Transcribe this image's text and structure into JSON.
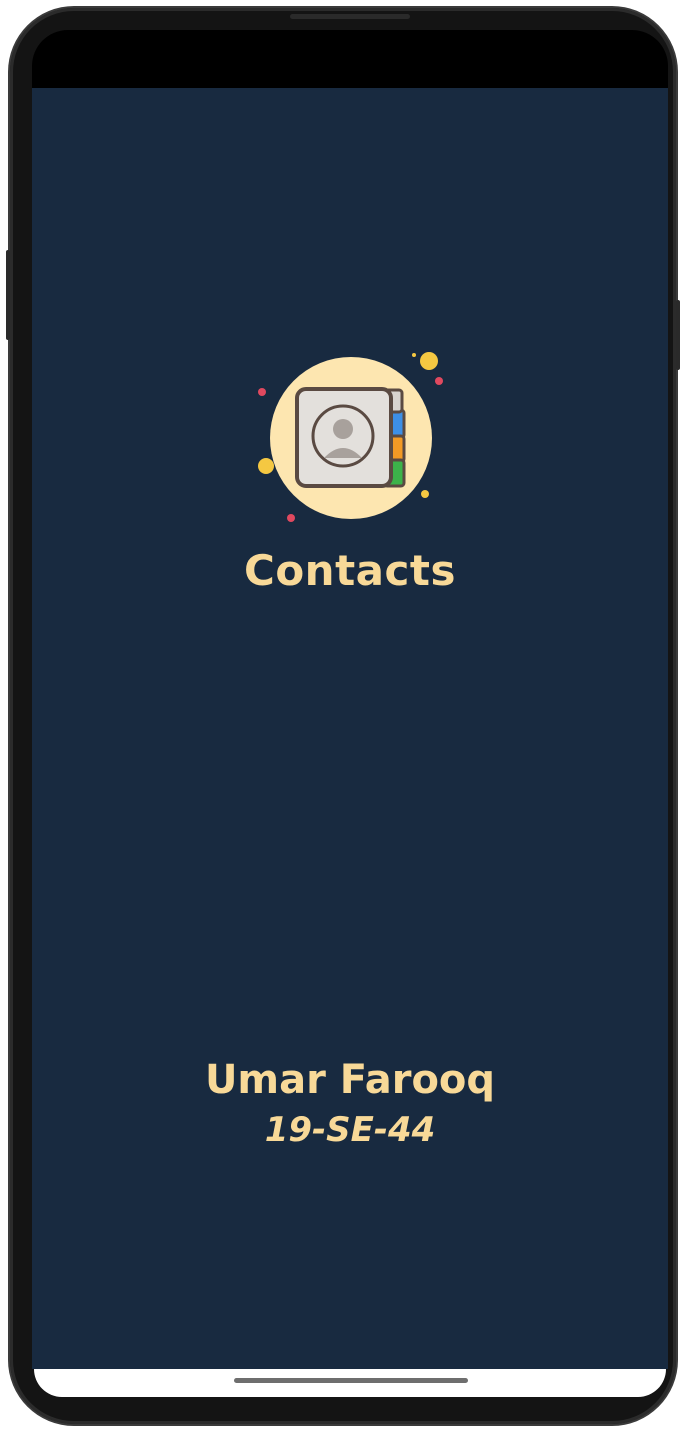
{
  "splash": {
    "app_title": "Contacts",
    "logo_icon": "contacts-book-icon",
    "author_name": "Umar Farooq",
    "author_id": "19-SE-44"
  },
  "colors": {
    "screen_background": "#182a40",
    "text_accent": "#f8d998",
    "logo_circle": "#fde6b0"
  }
}
